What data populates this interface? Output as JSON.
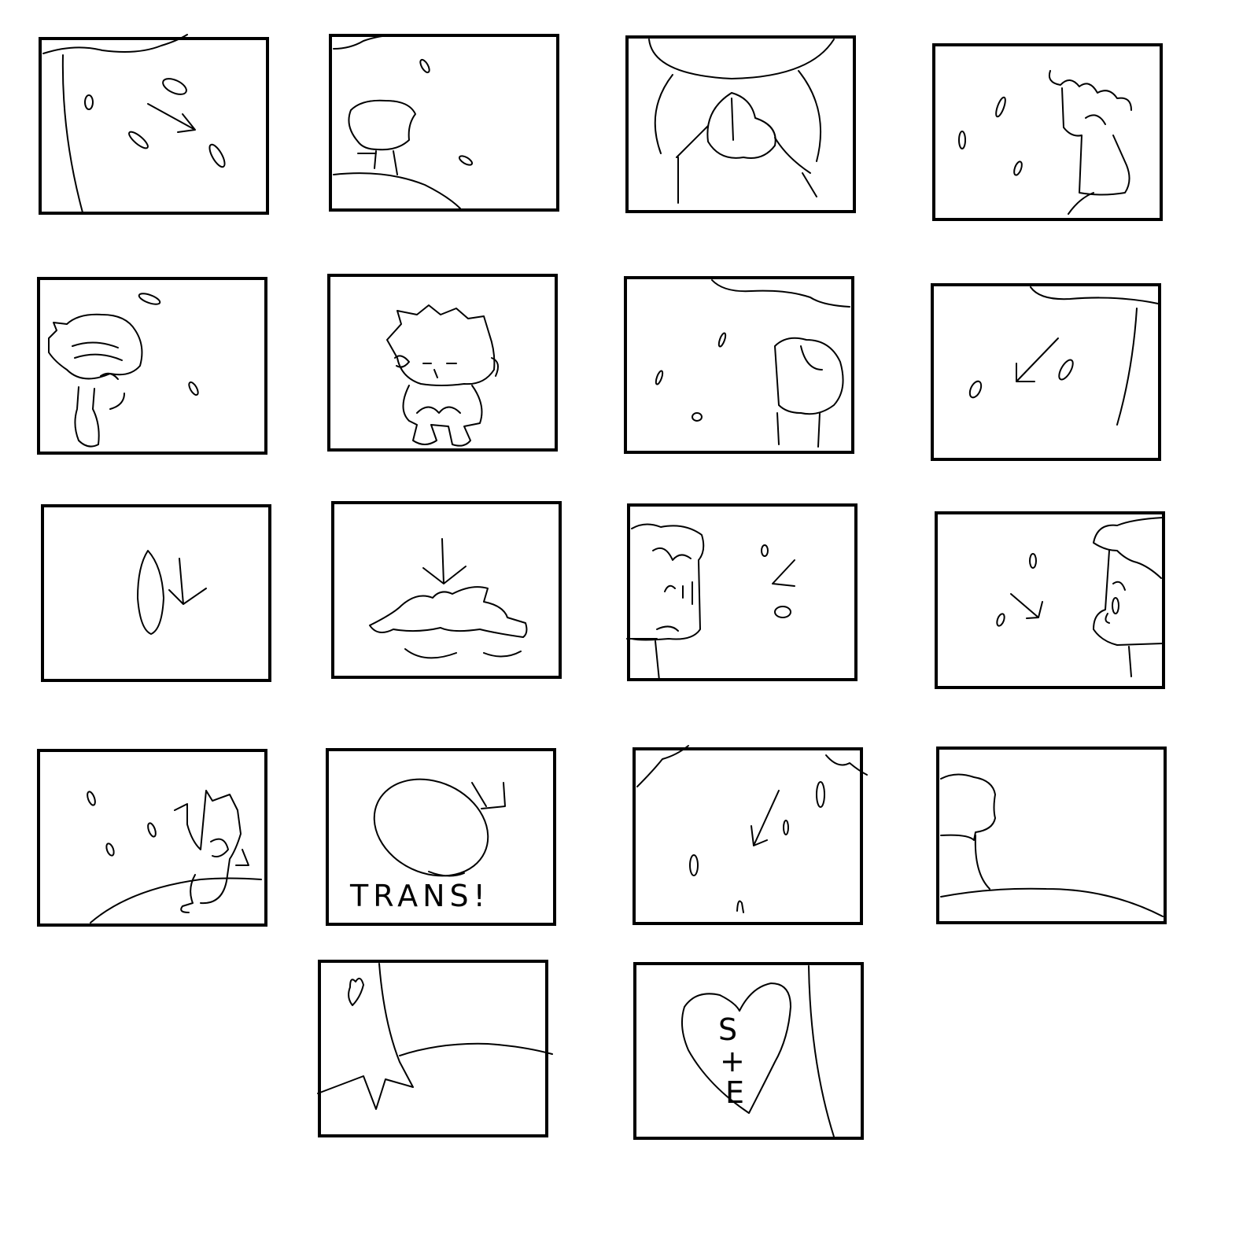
{
  "board": {
    "panel_count": 18,
    "panel_order": [
      "1",
      "2",
      "3",
      "4",
      "5",
      "6",
      "7",
      "8",
      "9",
      "10",
      "11",
      "12",
      "13",
      "14",
      "15",
      "16",
      "17",
      "18"
    ]
  },
  "captions": {
    "trans": "TRANS!",
    "initials_s": "S",
    "initials_plus": "+",
    "initials_e": "E"
  },
  "colors": {
    "ink": "#000000",
    "paper": "#ffffff"
  }
}
